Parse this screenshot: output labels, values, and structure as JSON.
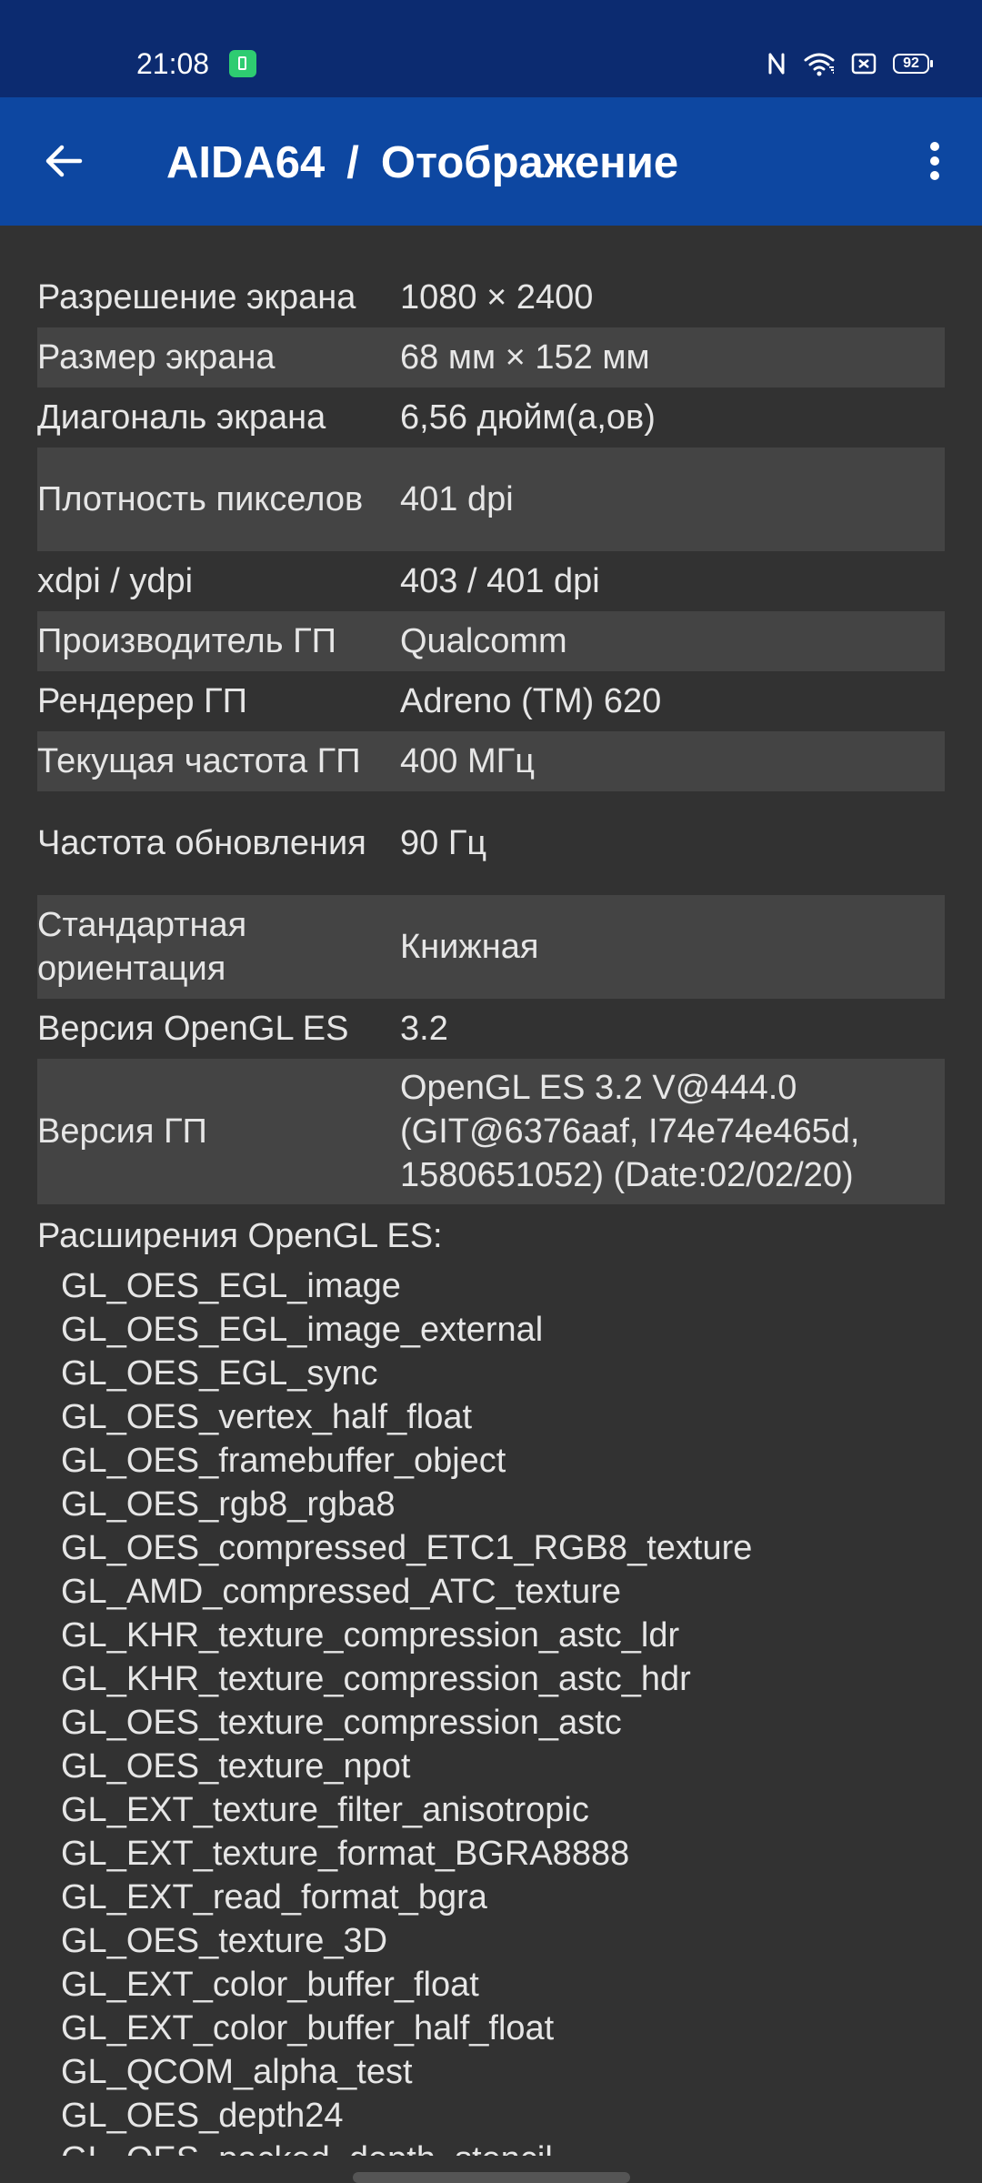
{
  "status_bar": {
    "time": "21:08",
    "battery": "92",
    "icons": [
      "notification-app-icon",
      "nfc-icon",
      "wifi-icon",
      "sim-card-icon",
      "battery-icon"
    ]
  },
  "app_bar": {
    "app_name": "AIDA64",
    "separator": "/",
    "section": "Отображение",
    "icons": [
      "back-arrow-icon",
      "more-vert-icon"
    ]
  },
  "rows": [
    {
      "label": "Разрешение экрана",
      "value": "1080 × 2400"
    },
    {
      "label": "Размер экрана",
      "value": "68 мм × 152 мм"
    },
    {
      "label": "Диагональ экрана",
      "value": "6,56 дюйм(а,ов)"
    },
    {
      "label": "Плотность пикселов",
      "value": "401 dpi"
    },
    {
      "label": "xdpi / ydpi",
      "value": "403 / 401 dpi"
    },
    {
      "label": "Производитель ГП",
      "value": "Qualcomm"
    },
    {
      "label": "Рендерер ГП",
      "value": "Adreno (TM) 620"
    },
    {
      "label": "Текущая частота ГП",
      "value": "400 МГц"
    },
    {
      "label": "Частота обновления",
      "value": "90 Гц"
    },
    {
      "label": "Стандартная ориентация",
      "value": "Книжная"
    },
    {
      "label": "Версия OpenGL ES",
      "value": "3.2"
    },
    {
      "label": "Версия ГП",
      "value": "OpenGL ES 3.2 V@444.0 (GIT@6376aaf, I74e74e465d, 1580651052) (Date:02/02/20)"
    }
  ],
  "extensions": {
    "title": "Расширения OpenGL ES:",
    "items": [
      "GL_OES_EGL_image",
      "GL_OES_EGL_image_external",
      "GL_OES_EGL_sync",
      "GL_OES_vertex_half_float",
      "GL_OES_framebuffer_object",
      "GL_OES_rgb8_rgba8",
      "GL_OES_compressed_ETC1_RGB8_texture",
      "GL_AMD_compressed_ATC_texture",
      "GL_KHR_texture_compression_astc_ldr",
      "GL_KHR_texture_compression_astc_hdr",
      "GL_OES_texture_compression_astc",
      "GL_OES_texture_npot",
      "GL_EXT_texture_filter_anisotropic",
      "GL_EXT_texture_format_BGRA8888",
      "GL_EXT_read_format_bgra",
      "GL_OES_texture_3D",
      "GL_EXT_color_buffer_float",
      "GL_EXT_color_buffer_half_float",
      "GL_QCOM_alpha_test",
      "GL_OES_depth24"
    ],
    "partial_item": "GL_OES_packed_depth_stencil"
  },
  "colors": {
    "status_bar": "#0c2b70",
    "app_bar": "#0d47a1",
    "background": "#323232",
    "row_alt": "#444444",
    "text": "#e6e6e6"
  }
}
